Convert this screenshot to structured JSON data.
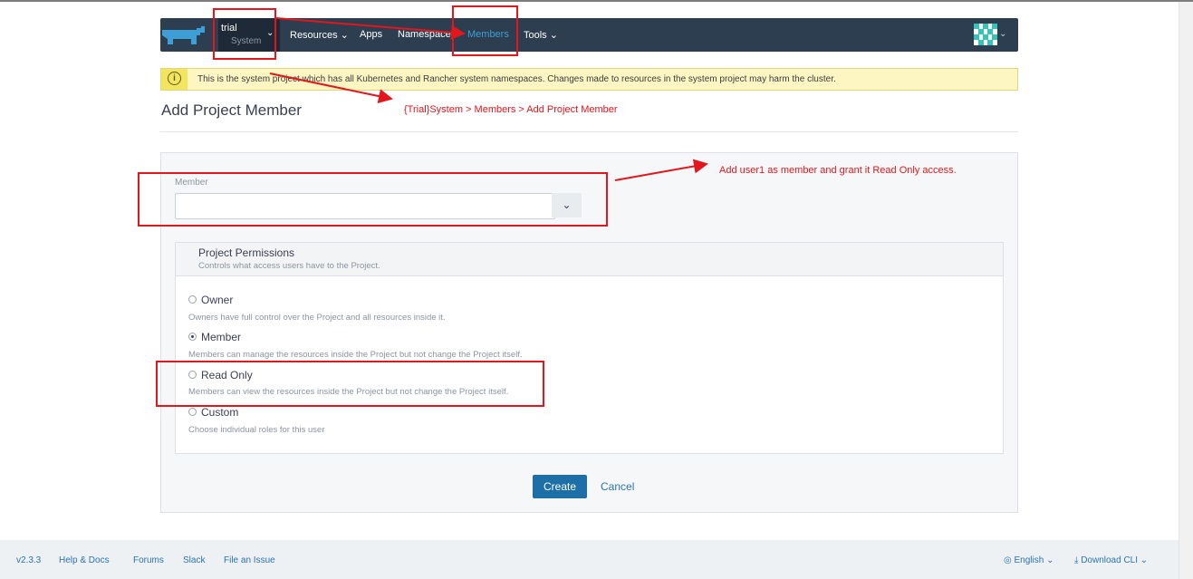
{
  "header": {
    "context": {
      "cluster": "trial",
      "project": "System"
    },
    "nav": [
      {
        "label": "Resources",
        "has_menu": true
      },
      {
        "label": "Apps",
        "has_menu": false
      },
      {
        "label": "Namespaces",
        "has_menu": false
      },
      {
        "label": "Members",
        "has_menu": false,
        "active": true
      },
      {
        "label": "Tools",
        "has_menu": true
      }
    ],
    "icons": {
      "logo": "rancher-logo",
      "avatar": "user-avatar",
      "chevron": "chevron-down-icon"
    }
  },
  "banner": {
    "text": "This is the system project which has all Kubernetes and Rancher system namespaces. Changes made to resources in the system project may harm the cluster.",
    "icon": "info-icon"
  },
  "page": {
    "title": "Add Project Member"
  },
  "form": {
    "member_label": "Member",
    "member_value": "",
    "permissions": {
      "title": "Project Permissions",
      "subtitle": "Controls what access users have to the Project.",
      "selected": "Member",
      "options": [
        {
          "label": "Owner",
          "desc": "Owners have full control over the Project and all resources inside it."
        },
        {
          "label": "Member",
          "desc": "Members can manage the resources inside the Project but not change the Project itself."
        },
        {
          "label": "Read Only",
          "desc": "Members can view the resources inside the Project but not change the Project itself."
        },
        {
          "label": "Custom",
          "desc": "Choose individual roles for this user"
        }
      ]
    },
    "create_label": "Create",
    "cancel_label": "Cancel"
  },
  "footer": {
    "version": "v2.3.3",
    "links": [
      "Help & Docs",
      "Forums",
      "Slack",
      "File an Issue"
    ],
    "language": "English",
    "download": "Download CLI"
  },
  "annotations": {
    "breadcrumb": "{Trial}System > Members > Add Project Member",
    "instruction": "Add user1 as member and grant it Read Only access."
  },
  "colors": {
    "header_bg": "#2d3e50",
    "active_nav": "#3d9fd6",
    "primary_button": "#1d6fa8",
    "annotation": "#e3161b",
    "banner_bg": "#fdf6c3"
  }
}
